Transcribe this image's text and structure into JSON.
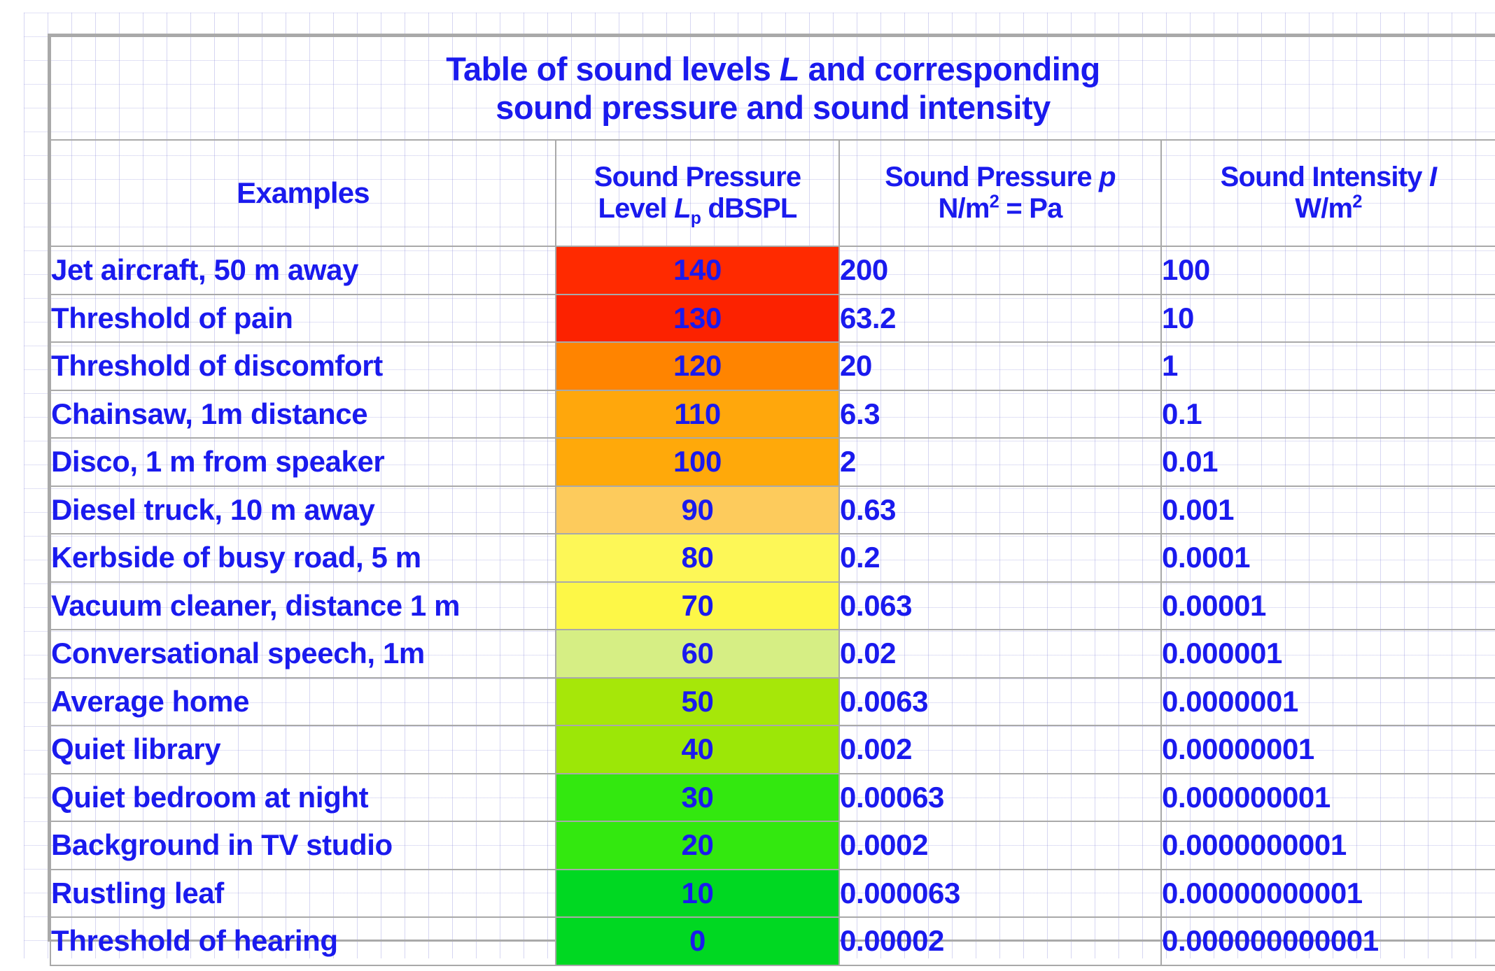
{
  "title": {
    "line1_a": "Table of sound levels ",
    "line1_italic": "L",
    "line1_b": " and corresponding",
    "line2": "sound pressure and sound intensity"
  },
  "columns": {
    "examples": "Examples",
    "spl_line1": "Sound Pressure",
    "spl_line2_a": "Level ",
    "spl_line2_italic": "L",
    "spl_line2_sub": "p",
    "spl_line2_b": " dBSPL",
    "pressure_line1_a": "Sound Pressure ",
    "pressure_line1_italic": "p",
    "pressure_line2_a": "N/m",
    "pressure_line2_sup": "2",
    "pressure_line2_b": " = Pa",
    "intensity_line1_a": "Sound Intensity ",
    "intensity_line1_italic": "I",
    "intensity_line2_a": "W/m",
    "intensity_line2_sup": "2"
  },
  "chart_data": {
    "type": "table",
    "title": "Table of sound levels L and corresponding sound pressure and sound intensity",
    "columns": [
      "Examples",
      "Sound Pressure Level Lp dBSPL",
      "Sound Pressure p N/m2 = Pa",
      "Sound Intensity I W/m2"
    ],
    "rows": [
      {
        "example": "Jet aircraft, 50 m away",
        "db": "140",
        "pressure": "200",
        "intensity": "100",
        "color": "#ff2a00"
      },
      {
        "example": "Threshold of pain",
        "db": "130",
        "pressure": "63.2",
        "intensity": "10",
        "color": "#fc2200"
      },
      {
        "example": "Threshold of discomfort",
        "db": "120",
        "pressure": "20",
        "intensity": "1",
        "color": "#ff8400"
      },
      {
        "example": "Chainsaw, 1m distance",
        "db": "110",
        "pressure": "6.3",
        "intensity": "0.1",
        "color": "#ffa70c"
      },
      {
        "example": "Disco, 1 m from speaker",
        "db": "100",
        "pressure": "2",
        "intensity": "0.01",
        "color": "#ffa90a"
      },
      {
        "example": "Diesel truck, 10 m away",
        "db": "90",
        "pressure": "0.63",
        "intensity": "0.001",
        "color": "#fdcb5c"
      },
      {
        "example": "Kerbside of busy road, 5 m",
        "db": "80",
        "pressure": "0.2",
        "intensity": "0.0001",
        "color": "#fdf757"
      },
      {
        "example": "Vacuum cleaner, distance 1 m",
        "db": "70",
        "pressure": "0.063",
        "intensity": "0.00001",
        "color": "#fdf747"
      },
      {
        "example": "Conversational speech, 1m",
        "db": "60",
        "pressure": "0.02",
        "intensity": "0.000001",
        "color": "#d6ee84"
      },
      {
        "example": "Average home",
        "db": "50",
        "pressure": "0.0063",
        "intensity": "0.0000001",
        "color": "#a6e709"
      },
      {
        "example": "Quiet library",
        "db": "40",
        "pressure": "0.002",
        "intensity": "0.00000001",
        "color": "#9ce707"
      },
      {
        "example": "Quiet bedroom at night",
        "db": "30",
        "pressure": "0.00063",
        "intensity": "0.000000001",
        "color": "#33e80f"
      },
      {
        "example": "Background in TV studio",
        "db": "20",
        "pressure": "0.0002",
        "intensity": "0.0000000001",
        "color": "#33e80f"
      },
      {
        "example": "Rustling leaf",
        "db": "10",
        "pressure": "0.000063",
        "intensity": "0.00000000001",
        "color": "#00d822"
      },
      {
        "example": "Threshold of hearing",
        "db": "0",
        "pressure": "0.00002",
        "intensity": "0.000000000001",
        "color": "#00d822"
      }
    ],
    "text_color": "#1a1aee",
    "title_background": "#f0f0f0",
    "border_color": "#a9a9a9"
  }
}
